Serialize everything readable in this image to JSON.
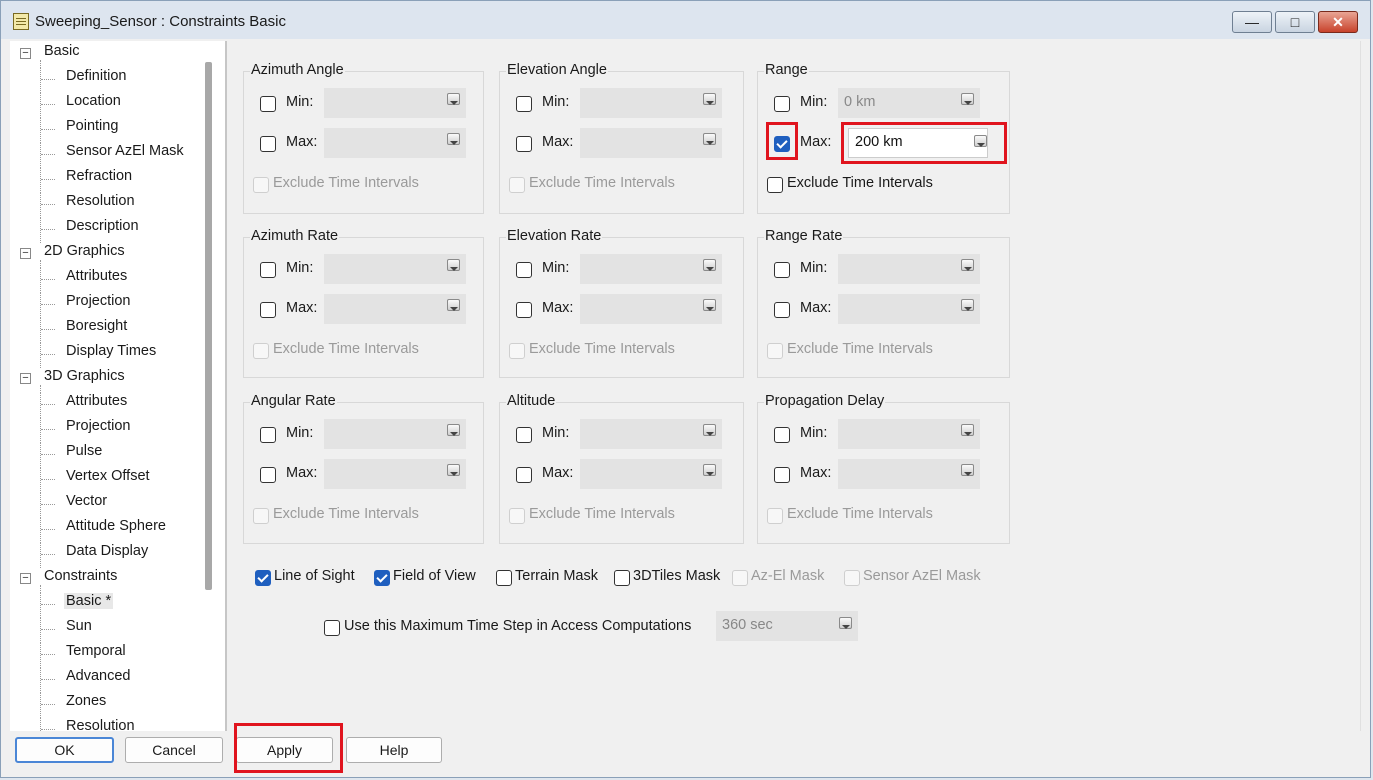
{
  "window": {
    "title": "Sweeping_Sensor : Constraints Basic",
    "minimize": "—",
    "maximize": "□",
    "close": "✕"
  },
  "tree": [
    {
      "label": "Basic",
      "level": 0,
      "expander": "−"
    },
    {
      "label": "Definition",
      "level": 1
    },
    {
      "label": "Location",
      "level": 1
    },
    {
      "label": "Pointing",
      "level": 1
    },
    {
      "label": "Sensor AzEl Mask",
      "level": 1
    },
    {
      "label": "Refraction",
      "level": 1
    },
    {
      "label": "Resolution",
      "level": 1
    },
    {
      "label": "Description",
      "level": 1
    },
    {
      "label": "2D Graphics",
      "level": 0,
      "expander": "−"
    },
    {
      "label": "Attributes",
      "level": 1
    },
    {
      "label": "Projection",
      "level": 1
    },
    {
      "label": "Boresight",
      "level": 1
    },
    {
      "label": "Display Times",
      "level": 1
    },
    {
      "label": "3D Graphics",
      "level": 0,
      "expander": "−"
    },
    {
      "label": "Attributes",
      "level": 1
    },
    {
      "label": "Projection",
      "level": 1
    },
    {
      "label": "Pulse",
      "level": 1
    },
    {
      "label": "Vertex Offset",
      "level": 1
    },
    {
      "label": "Vector",
      "level": 1
    },
    {
      "label": "Attitude Sphere",
      "level": 1
    },
    {
      "label": "Data Display",
      "level": 1
    },
    {
      "label": "Constraints",
      "level": 0,
      "expander": "−"
    },
    {
      "label": "Basic *",
      "level": 1,
      "selected": true
    },
    {
      "label": "Sun",
      "level": 1
    },
    {
      "label": "Temporal",
      "level": 1
    },
    {
      "label": "Advanced",
      "level": 1
    },
    {
      "label": "Zones",
      "level": 1
    },
    {
      "label": "Resolution",
      "level": 1
    }
  ],
  "labels": {
    "min": "Min:",
    "max": "Max:",
    "exclude": "Exclude Time Intervals"
  },
  "groups": [
    {
      "title": "Azimuth Angle",
      "min_checked": false,
      "max_checked": false,
      "min_value": "",
      "max_value": "",
      "exclude_enabled": false,
      "exclude_checked": false
    },
    {
      "title": "Elevation Angle",
      "min_checked": false,
      "max_checked": false,
      "min_value": "",
      "max_value": "",
      "exclude_enabled": false,
      "exclude_checked": false
    },
    {
      "title": "Range",
      "min_checked": false,
      "max_checked": true,
      "min_value": "0 km",
      "max_value": "200 km",
      "exclude_enabled": true,
      "exclude_checked": false
    },
    {
      "title": "Azimuth Rate",
      "min_checked": false,
      "max_checked": false,
      "min_value": "",
      "max_value": "",
      "exclude_enabled": false,
      "exclude_checked": false
    },
    {
      "title": "Elevation Rate",
      "min_checked": false,
      "max_checked": false,
      "min_value": "",
      "max_value": "",
      "exclude_enabled": false,
      "exclude_checked": false
    },
    {
      "title": "Range Rate",
      "min_checked": false,
      "max_checked": false,
      "min_value": "",
      "max_value": "",
      "exclude_enabled": false,
      "exclude_checked": false
    },
    {
      "title": "Angular Rate",
      "min_checked": false,
      "max_checked": false,
      "min_value": "",
      "max_value": "",
      "exclude_enabled": false,
      "exclude_checked": false
    },
    {
      "title": "Altitude",
      "min_checked": false,
      "max_checked": false,
      "min_value": "",
      "max_value": "",
      "exclude_enabled": false,
      "exclude_checked": false
    },
    {
      "title": "Propagation Delay",
      "min_checked": false,
      "max_checked": false,
      "min_value": "",
      "max_value": "",
      "exclude_enabled": false,
      "exclude_checked": false
    }
  ],
  "options": [
    {
      "label": "Line of Sight",
      "checked": true,
      "enabled": true
    },
    {
      "label": "Field of View",
      "checked": true,
      "enabled": true
    },
    {
      "label": "Terrain Mask",
      "checked": false,
      "enabled": true
    },
    {
      "label": "3DTiles Mask",
      "checked": false,
      "enabled": true
    },
    {
      "label": "Az-El Mask",
      "checked": false,
      "enabled": false
    },
    {
      "label": "Sensor AzEl Mask",
      "checked": false,
      "enabled": false
    }
  ],
  "timestep": {
    "label": "Use this Maximum Time Step in Access Computations",
    "checked": false,
    "value": "360 sec"
  },
  "buttons": {
    "ok": "OK",
    "cancel": "Cancel",
    "apply": "Apply",
    "help": "Help"
  },
  "colors": {
    "highlight": "#e0141e",
    "check": "#1f5fbf"
  }
}
